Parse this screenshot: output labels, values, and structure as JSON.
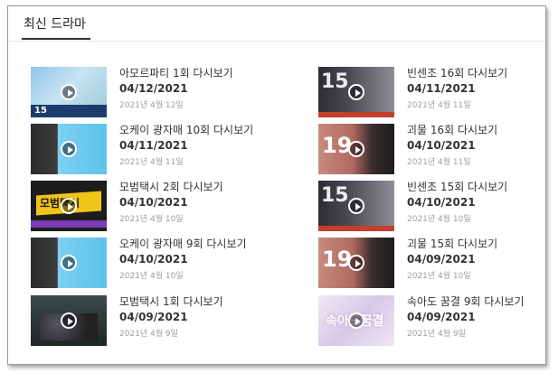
{
  "section": {
    "title": "최신 드라마"
  },
  "items": [
    {
      "title": "아모르파티 1회 다시보기",
      "date_bold": "04/12/2021",
      "date": "2021년 4월 12일",
      "thumb": "amor",
      "thumb_text": "15"
    },
    {
      "title": "빈센조 16회 다시보기",
      "date_bold": "04/11/2021",
      "date": "2021년 4월 11일",
      "thumb": "vin",
      "thumb_text": "15"
    },
    {
      "title": "오케이 광자매 10회 다시보기",
      "date_bold": "04/11/2021",
      "date": "2021년 4월 11일",
      "thumb": "okay",
      "thumb_text": ""
    },
    {
      "title": "괴물 16회 다시보기",
      "date_bold": "04/10/2021",
      "date": "2021년 4월 11일",
      "thumb": "gw",
      "thumb_text": "19"
    },
    {
      "title": "모범택시 2회 다시보기",
      "date_bold": "04/10/2021",
      "date": "2021년 4월 10일",
      "thumb": "taxi",
      "thumb_text": "모범택시"
    },
    {
      "title": "빈센조 15회 다시보기",
      "date_bold": "04/10/2021",
      "date": "2021년 4월 10일",
      "thumb": "vin",
      "thumb_text": "15"
    },
    {
      "title": "오케이 광자매 9회 다시보기",
      "date_bold": "04/10/2021",
      "date": "2021년 4월 10일",
      "thumb": "okay",
      "thumb_text": ""
    },
    {
      "title": "괴물 15회 다시보기",
      "date_bold": "04/09/2021",
      "date": "2021년 4월 10일",
      "thumb": "gw",
      "thumb_text": "19"
    },
    {
      "title": "모범택시 1회 다시보기",
      "date_bold": "04/09/2021",
      "date": "2021년 4월 9일",
      "thumb": "taxi2",
      "thumb_text": ""
    },
    {
      "title": "속아도 꿈결 9회 다시보기",
      "date_bold": "04/09/2021",
      "date": "2021년 4월 9일",
      "thumb": "dream",
      "thumb_text": "속아도꿈결"
    }
  ],
  "icons": {
    "play": "play-icon"
  }
}
